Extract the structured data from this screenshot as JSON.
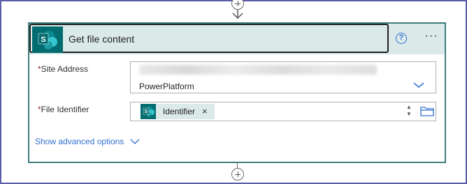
{
  "action": {
    "title": "Get file content",
    "icon": "sharepoint-icon",
    "logo_letter": "S",
    "help_symbol": "?",
    "more_symbol": "···"
  },
  "fields": {
    "site_address": {
      "required_mark": "*",
      "label": "Site Address",
      "value": "PowerPlatform"
    },
    "file_identifier": {
      "required_mark": "*",
      "label": "File Identifier",
      "token": "Identifier",
      "token_remove": "×"
    }
  },
  "advanced": {
    "label": "Show advanced options"
  },
  "colors": {
    "frame_border": "#5b5ba8",
    "card_border": "#3b7d7d",
    "header_bg": "#dbe9e9",
    "sharepoint": "#036c70",
    "link": "#2f6fd0",
    "required": "#a4262c"
  }
}
